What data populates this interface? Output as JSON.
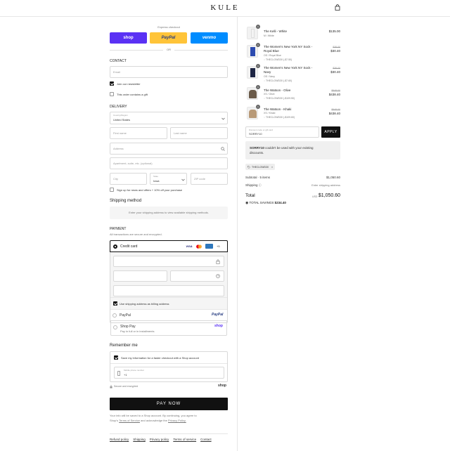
{
  "header": {
    "logo": "KULE"
  },
  "express": {
    "title": "Express checkout",
    "shop_label": "shop",
    "paypal_label": "PayPal",
    "venmo_label": "venmo",
    "or": "OR"
  },
  "contact": {
    "heading": "CONTACT",
    "email_placeholder": "Email",
    "newsletter_label": "Join our newsletter",
    "gift_label": "This order contains a gift"
  },
  "delivery": {
    "heading": "DELIVERY",
    "country_label": "Country/Region",
    "country_value": "United States",
    "first_name": "First name",
    "last_name": "Last name",
    "address": "Address",
    "apartment": "Apartment, suite, etc. (optional)",
    "city": "City",
    "state_label": "State",
    "state_value": "Iowa",
    "zip": "ZIP code",
    "sms_label": "Sign up for news and offers + 10% off your purchase"
  },
  "shipping_method": {
    "heading": "Shipping method",
    "placeholder": "Enter your shipping address to view available shipping methods."
  },
  "payment": {
    "heading": "PAYMENT",
    "subtitle": "All transactions are secure and encrypted.",
    "credit_card_label": "Credit card",
    "more_cards": "+5",
    "billing_label": "Use shipping address as billing address",
    "paypal_label": "PayPal",
    "paypal_logo": "PayPal",
    "shoppay_label": "Shop Pay",
    "shoppay_sub": "Pay in full or in installments",
    "shoppay_logo": "shop"
  },
  "remember": {
    "heading": "Remember me",
    "save_label": "Save my information for a faster checkout with a Shop account",
    "phone_label": "Mobile phone number",
    "phone_value": "+1",
    "secure_label": "Secure and encrypted",
    "shop_logo": "shop"
  },
  "pay_button": "PAY NOW",
  "terms": {
    "line1": "Your info will be saved to a Shop account. By continuing, you agree to",
    "shop": "Shop's",
    "tos": "Terms of Service",
    "and": "and acknowledge the",
    "privacy": "Privacy Policy."
  },
  "footer_links": [
    "Refund policy",
    "Shipping",
    "Privacy policy",
    "Terms of service",
    "Contact"
  ],
  "cart": {
    "items": [
      {
        "qty": "1",
        "name": "The Kelli - White",
        "variant": "M / White",
        "discount": "",
        "price_old": "",
        "price": "$135.00",
        "color": "#f4f4f4"
      },
      {
        "qty": "1",
        "name": "The Women's New York NY Sock - Royal Blue",
        "variant": "OS / Royal Blue",
        "discount": "THECLOWD30 (-$7.50)",
        "price_old": "$38.00",
        "price": "$30.40",
        "color": "#2d4bb0"
      },
      {
        "qty": "1",
        "name": "The Women's New York NY Sock - Navy",
        "variant": "OS / Navy",
        "discount": "THECLOWD30 (-$7.60)",
        "price_old": "$38.00",
        "price": "$30.40",
        "color": "#1d2544"
      },
      {
        "qty": "1",
        "name": "The Watson - Olive",
        "variant": "XS / Olive",
        "discount": "THECLOWD30 (-$109.50)",
        "price_old": "$548.00",
        "price": "$438.40",
        "color": "#6b5b4a"
      },
      {
        "qty": "1",
        "name": "The Watson - Khaki",
        "variant": "XS / Khaki",
        "discount": "THECLOWD30 (-$109.60)",
        "price_old": "$548.00",
        "price": "$438.40",
        "color": "#b89a78"
      }
    ],
    "discount_label": "Discount code or gift card",
    "discount_value": "SORRY10",
    "apply": "APPLY",
    "error_bold": "SORRY10",
    "error_text": "couldn't be used with your existing discounts.",
    "error_line2": "discounts.",
    "applied_code": "THECLOWD30",
    "subtotal_label": "Subtotal · 5 items",
    "subtotal_value": "$1,050.60",
    "shipping_label": "Shipping",
    "shipping_value": "Enter shipping address",
    "total_label": "Total",
    "currency": "USD",
    "total_value": "$1,050.60",
    "savings_label": "TOTAL SAVINGS",
    "savings_value": "$234.40"
  },
  "colors": {
    "shop": "#5a31f4",
    "paypal": "#ffc439",
    "venmo": "#008cff",
    "dark": "#111111"
  }
}
